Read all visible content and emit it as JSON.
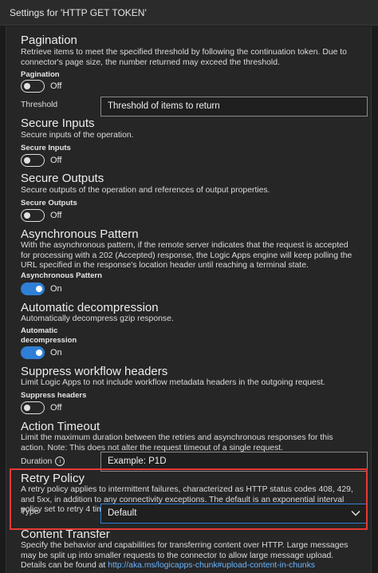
{
  "window": {
    "title": "Settings for 'HTTP GET TOKEN'"
  },
  "pagination": {
    "heading": "Pagination",
    "description": "Retrieve items to meet the specified threshold by following the continuation token. Due to connector's page size, the number returned may exceed the threshold.",
    "toggle_label": "Pagination",
    "toggle_state": "Off",
    "threshold_label": "Threshold",
    "threshold_placeholder": "Threshold of items to return"
  },
  "secure_inputs": {
    "heading": "Secure Inputs",
    "description": "Secure inputs of the operation.",
    "toggle_label": "Secure Inputs",
    "toggle_state": "Off"
  },
  "secure_outputs": {
    "heading": "Secure Outputs",
    "description": "Secure outputs of the operation and references of output properties.",
    "toggle_label": "Secure Outputs",
    "toggle_state": "Off"
  },
  "async_pattern": {
    "heading": "Asynchronous Pattern",
    "description": "With the asynchronous pattern, if the remote server indicates that the request is accepted for processing with a 202 (Accepted) response, the Logic Apps engine will keep polling the URL specified in the response's location header until reaching a terminal state.",
    "toggle_label": "Asynchronous Pattern",
    "toggle_state": "On"
  },
  "decompression": {
    "heading": "Automatic decompression",
    "description": "Automatically decompress gzip response.",
    "toggle_label_line1": "Automatic",
    "toggle_label_line2": "decompression",
    "toggle_state": "On"
  },
  "suppress_headers": {
    "heading": "Suppress workflow headers",
    "description": "Limit Logic Apps to not include workflow metadata headers in the outgoing request.",
    "toggle_label": "Suppress headers",
    "toggle_state": "Off"
  },
  "action_timeout": {
    "heading": "Action Timeout",
    "description": "Limit the maximum duration between the retries and asynchronous responses for this action. Note: This does not alter the request timeout of a single request.",
    "duration_label": "Duration",
    "duration_placeholder": "Example: P1D"
  },
  "retry_policy": {
    "heading": "Retry Policy",
    "description": "A retry policy applies to intermittent failures, characterized as HTTP status codes 408, 429, and 5xx, in addition to any connectivity exceptions. The default is an exponential interval policy set to retry 4 times.",
    "type_label": "Type",
    "type_value": "Default"
  },
  "content_transfer": {
    "heading": "Content Transfer",
    "description": "Specify the behavior and capabilities for transferring content over HTTP. Large messages may be split up into smaller requests to the connector to allow large message upload. Details can be found at",
    "link": "http://aka.ms/logicapps-chunk#upload-content-in-chunks"
  },
  "colors": {
    "accent": "#2f7fd6",
    "highlight_border": "#e53935",
    "background": "#262626"
  }
}
